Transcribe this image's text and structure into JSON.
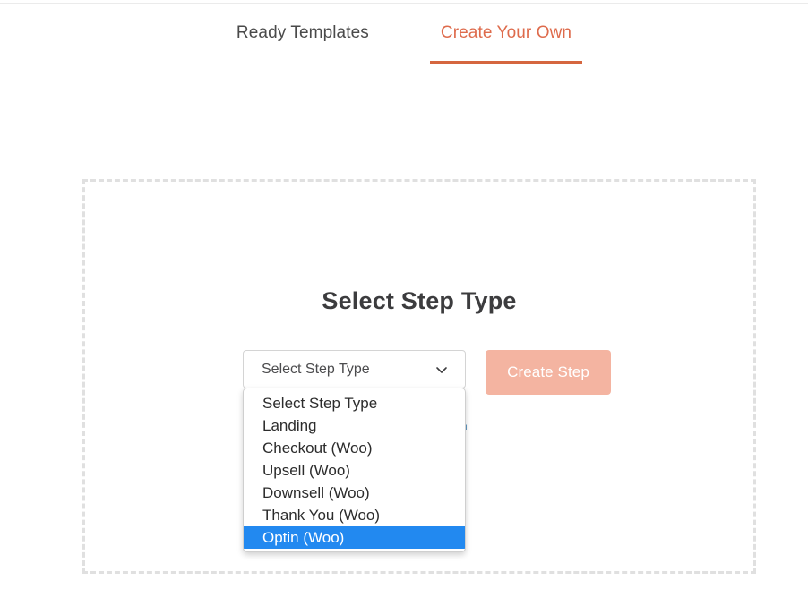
{
  "tabs": [
    {
      "label": "Ready Templates",
      "active": false
    },
    {
      "label": "Create Your Own",
      "active": true
    }
  ],
  "panel": {
    "title": "Select Step Type"
  },
  "step_form": {
    "select": {
      "value": "Select Step Type",
      "placeholder": "Select Step Type",
      "expanded": true,
      "options": [
        "Select Step Type",
        "Landing",
        "Checkout (Woo)",
        "Upsell (Woo)",
        "Downsell (Woo)",
        "Thank You (Woo)",
        "Optin (Woo)"
      ],
      "highlighted_option": "Optin (Woo)"
    },
    "create_button": {
      "label": "Create Step"
    }
  },
  "icons": {
    "chevron": "chevron-down-icon",
    "external_link": "external-link-icon"
  },
  "colors": {
    "accent": "#d5663f",
    "accent_text": "#de6b4c",
    "button_bg": "#f4b4a1",
    "highlight": "#2289f0",
    "dashed_border": "#e0e0e0",
    "external_link": "#1f6ea8"
  }
}
